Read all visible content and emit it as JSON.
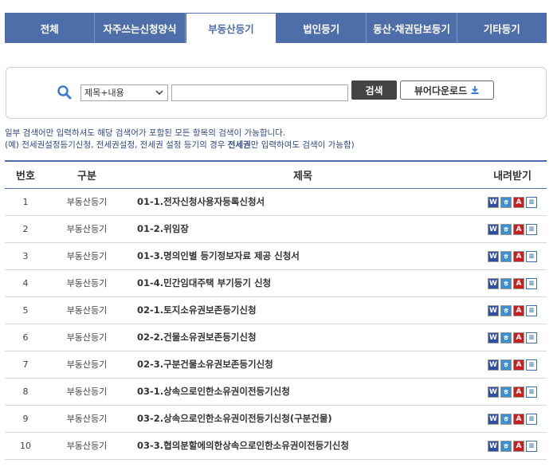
{
  "tabs": [
    {
      "label": "전체",
      "active": false
    },
    {
      "label": "자주쓰는신청양식",
      "active": false
    },
    {
      "label": "부동산등기",
      "active": true
    },
    {
      "label": "법인등기",
      "active": false
    },
    {
      "label": "동산·채권담보등기",
      "active": false
    },
    {
      "label": "기타등기",
      "active": false
    }
  ],
  "search": {
    "select_value": "제목+내용",
    "input_value": "",
    "search_label": "검색",
    "viewer_label": "뷰어다운로드"
  },
  "notice": {
    "line1": "일부 검색어만 입력하셔도 해당 검색어가 포함된 모든 항목의 검색이 가능합니다.",
    "line2_pre": "(예) 전세권설정등기신청, 전세권설정, 전세권 설정 등기의 경우 ",
    "line2_bold": "전세권",
    "line2_post": "만 입력하여도 검색이 가능함)"
  },
  "table": {
    "headers": {
      "num": "번호",
      "cat": "구분",
      "title": "제목",
      "dl": "내려받기"
    },
    "rows": [
      {
        "num": "1",
        "cat": "부동산등기",
        "title": "01-1.전자신청사용자등록신청서"
      },
      {
        "num": "2",
        "cat": "부동산등기",
        "title": "01-2.위임장"
      },
      {
        "num": "3",
        "cat": "부동산등기",
        "title": "01-3.명의인별 등기정보자료 제공 신청서"
      },
      {
        "num": "4",
        "cat": "부동산등기",
        "title": "01-4.민간임대주택 부기등기 신청"
      },
      {
        "num": "5",
        "cat": "부동산등기",
        "title": "02-1.토지소유권보존등기신청"
      },
      {
        "num": "6",
        "cat": "부동산등기",
        "title": "02-2.건물소유권보존등기신청"
      },
      {
        "num": "7",
        "cat": "부동산등기",
        "title": "02-3.구분건물소유권보존등기신청"
      },
      {
        "num": "8",
        "cat": "부동산등기",
        "title": "03-1.상속으로인한소유권이전등기신청"
      },
      {
        "num": "9",
        "cat": "부동산등기",
        "title": "03-2.상속으로인한소유권이전등기신청(구분건물)"
      },
      {
        "num": "10",
        "cat": "부동산등기",
        "title": "03-3.협의분할에의한상속으로인한소유권이전등기신청"
      }
    ]
  },
  "file_icons": [
    "word-icon",
    "hwp-icon",
    "pdf-icon",
    "text-icon"
  ],
  "colors": {
    "accent": "#4e6ea9",
    "notice": "#2e4a8a",
    "search_button": "#444444"
  }
}
